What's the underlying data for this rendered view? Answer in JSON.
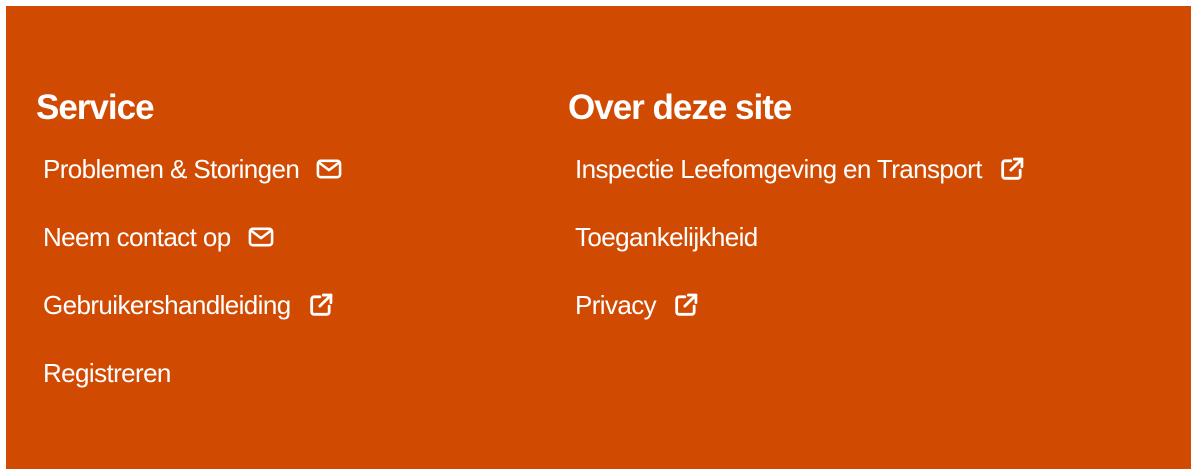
{
  "service": {
    "heading": "Service",
    "links": [
      {
        "label": "Problemen & Storingen",
        "icon": "mail-icon"
      },
      {
        "label": "Neem contact op",
        "icon": "mail-icon"
      },
      {
        "label": "Gebruikershandleiding",
        "icon": "external-link-icon"
      },
      {
        "label": "Registreren",
        "icon": null
      }
    ]
  },
  "about": {
    "heading": "Over deze site",
    "links": [
      {
        "label": "Inspectie Leefomgeving en Transport",
        "icon": "external-link-icon"
      },
      {
        "label": "Toegankelijkheid",
        "icon": null
      },
      {
        "label": "Privacy",
        "icon": "external-link-icon"
      }
    ]
  },
  "colors": {
    "background": "#d04a02",
    "text": "#ffffff"
  }
}
